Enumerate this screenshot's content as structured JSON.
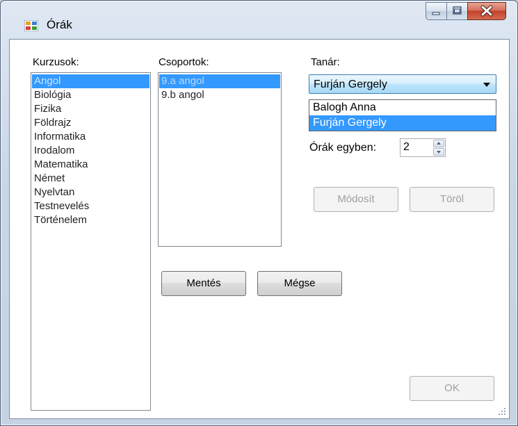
{
  "window": {
    "title": "Órák"
  },
  "kurzusok": {
    "label": "Kurzusok:",
    "items": [
      "Angol",
      "Biológia",
      "Fizika",
      "Földrajz",
      "Informatika",
      "Irodalom",
      "Matematika",
      "Német",
      "Nyelvtan",
      "Testnevelés",
      "Történelem"
    ],
    "selected": "Angol"
  },
  "csoportok": {
    "label": "Csoportok:",
    "items": [
      "9.a angol",
      "9.b angol"
    ],
    "selected": "9.a angol"
  },
  "tanar": {
    "label": "Tanár:",
    "value": "Furján Gergely",
    "options": [
      "Balogh Anna",
      "Furján Gergely"
    ]
  },
  "orak_egyben": {
    "label": "Órák egyben:",
    "value": "2"
  },
  "buttons": {
    "modosit": "Módosít",
    "torol": "Töröl",
    "mentes": "Mentés",
    "megse": "Mégse",
    "ok": "OK"
  },
  "colors": {
    "selection": "#3399ff",
    "titlebar": "#c8d6e7",
    "close_button": "#c2412b"
  }
}
